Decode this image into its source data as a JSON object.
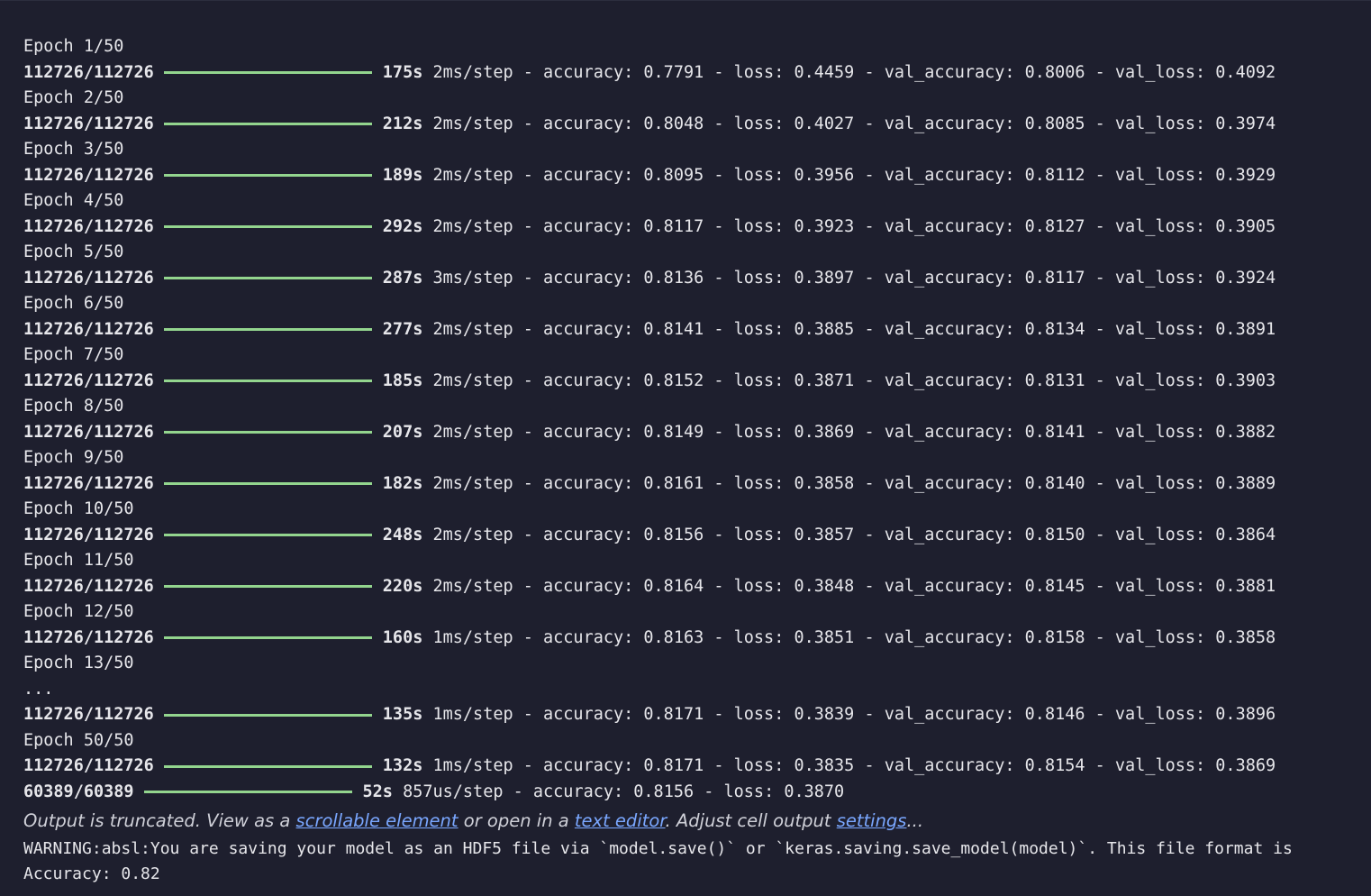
{
  "epochs": [
    {
      "header": "Epoch 1/50",
      "steps": "112726/112726",
      "time": "175s",
      "step_time": "2ms/step",
      "accuracy": "0.7791",
      "loss": "0.4459",
      "val_accuracy": "0.8006",
      "val_loss": "0.4092"
    },
    {
      "header": "Epoch 2/50",
      "steps": "112726/112726",
      "time": "212s",
      "step_time": "2ms/step",
      "accuracy": "0.8048",
      "loss": "0.4027",
      "val_accuracy": "0.8085",
      "val_loss": "0.3974"
    },
    {
      "header": "Epoch 3/50",
      "steps": "112726/112726",
      "time": "189s",
      "step_time": "2ms/step",
      "accuracy": "0.8095",
      "loss": "0.3956",
      "val_accuracy": "0.8112",
      "val_loss": "0.3929"
    },
    {
      "header": "Epoch 4/50",
      "steps": "112726/112726",
      "time": "292s",
      "step_time": "2ms/step",
      "accuracy": "0.8117",
      "loss": "0.3923",
      "val_accuracy": "0.8127",
      "val_loss": "0.3905"
    },
    {
      "header": "Epoch 5/50",
      "steps": "112726/112726",
      "time": "287s",
      "step_time": "3ms/step",
      "accuracy": "0.8136",
      "loss": "0.3897",
      "val_accuracy": "0.8117",
      "val_loss": "0.3924"
    },
    {
      "header": "Epoch 6/50",
      "steps": "112726/112726",
      "time": "277s",
      "step_time": "2ms/step",
      "accuracy": "0.8141",
      "loss": "0.3885",
      "val_accuracy": "0.8134",
      "val_loss": "0.3891"
    },
    {
      "header": "Epoch 7/50",
      "steps": "112726/112726",
      "time": "185s",
      "step_time": "2ms/step",
      "accuracy": "0.8152",
      "loss": "0.3871",
      "val_accuracy": "0.8131",
      "val_loss": "0.3903"
    },
    {
      "header": "Epoch 8/50",
      "steps": "112726/112726",
      "time": "207s",
      "step_time": "2ms/step",
      "accuracy": "0.8149",
      "loss": "0.3869",
      "val_accuracy": "0.8141",
      "val_loss": "0.3882"
    },
    {
      "header": "Epoch 9/50",
      "steps": "112726/112726",
      "time": "182s",
      "step_time": "2ms/step",
      "accuracy": "0.8161",
      "loss": "0.3858",
      "val_accuracy": "0.8140",
      "val_loss": "0.3889"
    },
    {
      "header": "Epoch 10/50",
      "steps": "112726/112726",
      "time": "248s",
      "step_time": "2ms/step",
      "accuracy": "0.8156",
      "loss": "0.3857",
      "val_accuracy": "0.8150",
      "val_loss": "0.3864"
    },
    {
      "header": "Epoch 11/50",
      "steps": "112726/112726",
      "time": "220s",
      "step_time": "2ms/step",
      "accuracy": "0.8164",
      "loss": "0.3848",
      "val_accuracy": "0.8145",
      "val_loss": "0.3881"
    },
    {
      "header": "Epoch 12/50",
      "steps": "112726/112726",
      "time": "160s",
      "step_time": "1ms/step",
      "accuracy": "0.8163",
      "loss": "0.3851",
      "val_accuracy": "0.8158",
      "val_loss": "0.3858"
    },
    {
      "header": "Epoch 13/50",
      "ellipsis": "..."
    },
    {
      "steps": "112726/112726",
      "time": "135s",
      "step_time": "1ms/step",
      "accuracy": "0.8171",
      "loss": "0.3839",
      "val_accuracy": "0.8146",
      "val_loss": "0.3896"
    },
    {
      "header": "Epoch 50/50",
      "steps": "112726/112726",
      "time": "132s",
      "step_time": "1ms/step",
      "accuracy": "0.8171",
      "loss": "0.3835",
      "val_accuracy": "0.8154",
      "val_loss": "0.3869"
    },
    {
      "steps": "60389/60389",
      "time": "52s",
      "step_time": "857us/step",
      "accuracy": "0.8156",
      "loss": "0.3870"
    }
  ],
  "truncation": {
    "prefix": "Output is truncated. View as a ",
    "link1": "scrollable element",
    "middle": " or open in a ",
    "link2": "text editor",
    "middle2": ". Adjust cell output ",
    "link3": "settings",
    "suffix": "..."
  },
  "warning": "WARNING:absl:You are saving your model as an HDF5 file via `model.save()` or `keras.saving.save_model(model)`. This file format is",
  "final_accuracy": "Accuracy: 0.82",
  "colors": {
    "background": "#1e1f2e",
    "progress_bar": "#93d58e",
    "link": "#7aa7ff",
    "text": "#e6e6ea"
  }
}
